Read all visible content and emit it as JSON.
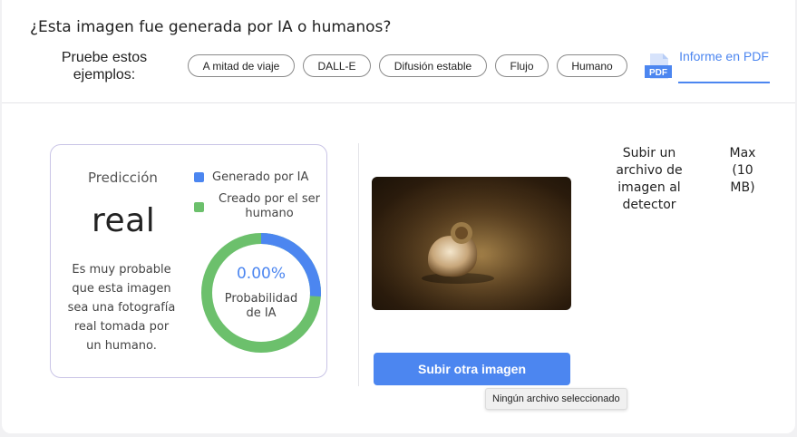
{
  "header": {
    "title": "¿Esta imagen fue generada por IA o humanos?",
    "examples_label": "Pruebe estos ejemplos:",
    "examples": [
      "A mitad de viaje",
      "DALL-E",
      "Difusión estable",
      "Flujo",
      "Humano"
    ],
    "pdf_icon_text": "PDF",
    "report_link": "Informe en PDF"
  },
  "prediction": {
    "label": "Predicción",
    "value": "real",
    "description": "Es muy probable que esta imagen sea una fotografía real tomada por un humano.",
    "legend_ai": "Generado por IA",
    "legend_human": "Creado por el ser humano",
    "ai_probability_text": "0.00%",
    "ai_probability_fraction": 0.0,
    "donut_label": "Probabilidad de IA",
    "colors": {
      "ai": "#4c86f0",
      "human": "#6cc06c"
    }
  },
  "upload": {
    "text": "Subir un archivo de imagen al detector",
    "max": "Max (10 MB)",
    "button": "Subir otra imagen",
    "tooltip": "Ningún archivo seleccionado"
  }
}
